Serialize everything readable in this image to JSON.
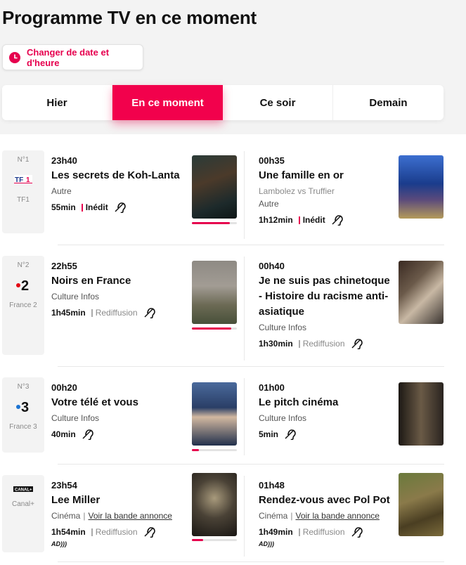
{
  "header": {
    "title": "Programme TV en ce moment",
    "date_button": "Changer de date et d'heure"
  },
  "tabs": [
    {
      "label": "Hier"
    },
    {
      "label": "En ce moment"
    },
    {
      "label": "Ce soir"
    },
    {
      "label": "Demain"
    }
  ],
  "colors": {
    "accent": "#e6004e"
  },
  "rows": [
    {
      "channel": {
        "num": "N°1",
        "name": "TF1",
        "logo": "TF1"
      },
      "now": {
        "time": "23h40",
        "title": "Les secrets de Koh-Lanta",
        "genre": "Autre",
        "duration": "55min",
        "tag": "Inédit",
        "progress": 0.85
      },
      "next": {
        "time": "00h35",
        "title": "Une famille en or",
        "subtitle": "Lambolez vs Truffier",
        "genre": "Autre",
        "duration": "1h12min",
        "tag": "Inédit"
      }
    },
    {
      "channel": {
        "num": "N°2",
        "name": "France 2",
        "logo": "2"
      },
      "now": {
        "time": "22h55",
        "title": "Noirs en France",
        "genre": "Culture Infos",
        "duration": "1h45min",
        "tag": "Rediffusion",
        "progress": 0.88
      },
      "next": {
        "time": "00h40",
        "title": "Je ne suis pas chinetoque - Histoire du racisme anti-asiatique",
        "genre": "Culture Infos",
        "duration": "1h30min",
        "tag": "Rediffusion"
      }
    },
    {
      "channel": {
        "num": "N°3",
        "name": "France 3",
        "logo": "3"
      },
      "now": {
        "time": "00h20",
        "title": "Votre télé et vous",
        "genre": "Culture Infos",
        "duration": "40min",
        "progress": 0.15
      },
      "next": {
        "time": "01h00",
        "title": "Le pitch cinéma",
        "genre": "Culture Infos",
        "duration": "5min"
      }
    },
    {
      "channel": {
        "num": "",
        "name": "Canal+",
        "logo": "CANAL+"
      },
      "now": {
        "time": "23h54",
        "title": "Lee Miller",
        "genre": "Cinéma",
        "link": "Voir la bande annonce",
        "duration": "1h54min",
        "tag": "Rediffusion",
        "ad": "AD)))",
        "progress": 0.25
      },
      "next": {
        "time": "01h48",
        "title": "Rendez-vous avec Pol Pot",
        "genre": "Cinéma",
        "link": "Voir la bande annonce",
        "duration": "1h49min",
        "tag": "Rediffusion",
        "ad": "AD)))"
      }
    }
  ]
}
